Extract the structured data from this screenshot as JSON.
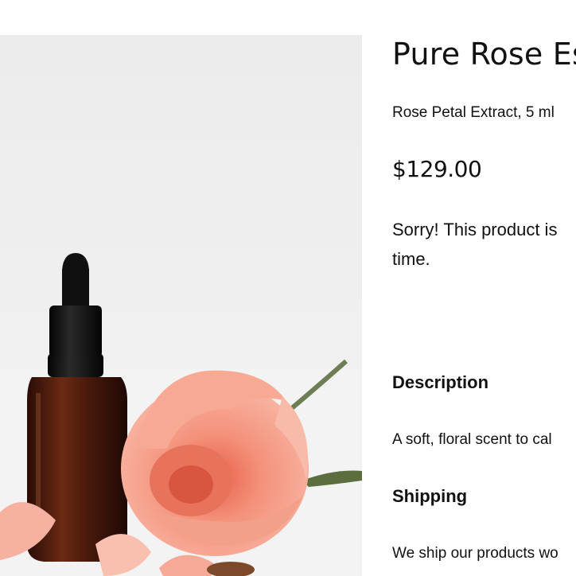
{
  "product": {
    "title": "Pure Rose Es",
    "variant": "Rose Petal Extract, 5 ml",
    "price": "$129.00",
    "availability_line1": "Sorry! This product is",
    "availability_line2": "time.",
    "image_alt": "Amber dropper bottle with pink roses"
  },
  "sections": {
    "description_heading": "Description",
    "description_text": "A soft, floral scent to cal",
    "shipping_heading": "Shipping",
    "shipping_text": "We ship our products wo"
  },
  "colors": {
    "text": "#111111",
    "background": "#ffffff",
    "image_background": "#ececec",
    "rose": "#f4967c",
    "bottle": "#4a1a0c"
  }
}
